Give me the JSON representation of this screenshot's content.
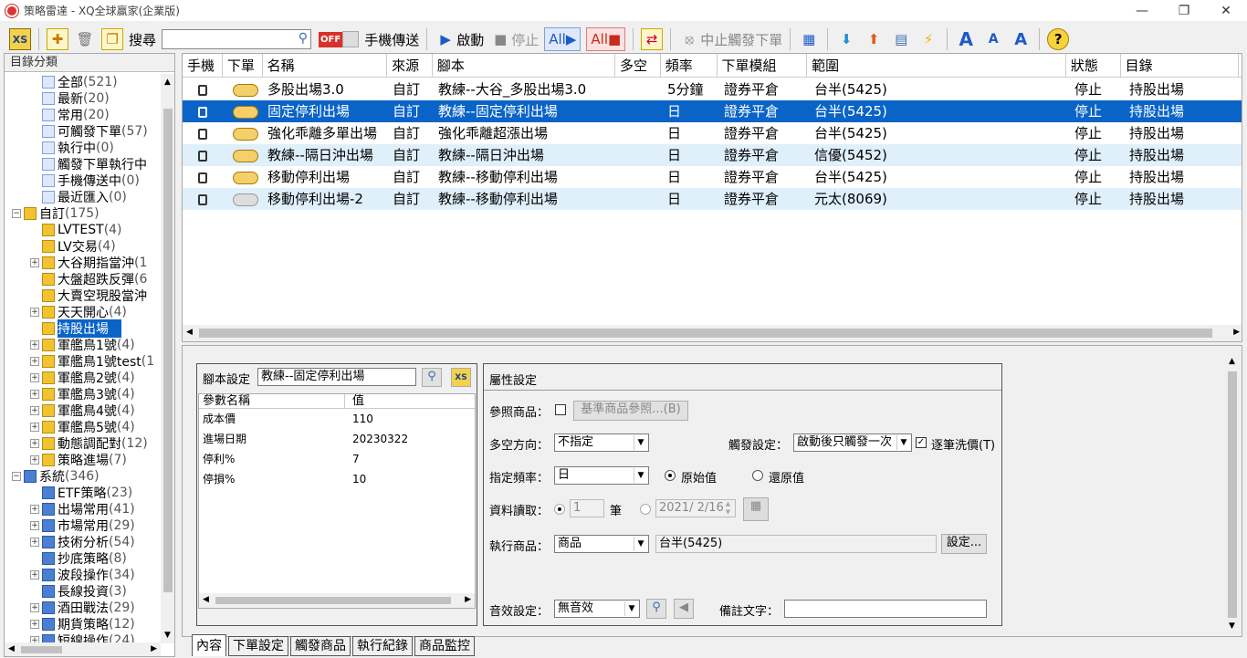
{
  "window": {
    "title": "策略雷達 - XQ全球贏家(企業版)",
    "min_icon": "minimize-icon",
    "restore_icon": "restore-icon",
    "close_icon": "close-icon"
  },
  "toolbar": {
    "search_label": "搜尋",
    "search_value": "",
    "phone_send_label": "手機傳送",
    "start_label": "啟動",
    "stop_label": "停止",
    "all_start_label": "All",
    "all_stop_label": "All",
    "stop_trigger_label": "中止觸發下單",
    "off_label": "OFF"
  },
  "sidebar": {
    "title": "目錄分類",
    "items": [
      {
        "label": "全部",
        "count": "(521)",
        "indent": 2,
        "pm": "",
        "icon": "all-icon"
      },
      {
        "label": "最新",
        "count": "(20)",
        "indent": 2,
        "pm": "",
        "icon": "new-icon"
      },
      {
        "label": "常用",
        "count": "(20)",
        "indent": 2,
        "pm": "",
        "icon": "star-icon"
      },
      {
        "label": "可觸發下單",
        "count": "(57)",
        "indent": 2,
        "pm": "",
        "icon": "trigger-order-icon"
      },
      {
        "label": "執行中",
        "count": "(0)",
        "indent": 2,
        "pm": "",
        "icon": "running-icon"
      },
      {
        "label": "觸發下單執行中",
        "count": "",
        "indent": 2,
        "pm": "",
        "icon": "trigger-running-icon"
      },
      {
        "label": "手機傳送中",
        "count": "(0)",
        "indent": 2,
        "pm": "",
        "icon": "phone-send-icon"
      },
      {
        "label": "最近匯入",
        "count": "(0)",
        "indent": 2,
        "pm": "",
        "icon": "import-icon"
      },
      {
        "label": "自訂",
        "count": "(175)",
        "indent": 0,
        "pm": "−",
        "icon": "folder-icon"
      },
      {
        "label": "LVTEST",
        "count": "(4)",
        "indent": 2,
        "pm": "",
        "icon": "folder-icon"
      },
      {
        "label": "LV交易",
        "count": "(4)",
        "indent": 2,
        "pm": "",
        "icon": "folder-icon"
      },
      {
        "label": "大谷期指當沖",
        "count": "(1",
        "indent": 1,
        "pm": "+",
        "icon": "folder-icon"
      },
      {
        "label": "大盤超跌反彈",
        "count": "(6",
        "indent": 2,
        "pm": "",
        "icon": "folder-icon"
      },
      {
        "label": "大賣空現股當沖",
        "count": "",
        "indent": 2,
        "pm": "",
        "icon": "folder-icon"
      },
      {
        "label": "天天開心",
        "count": "(4)",
        "indent": 1,
        "pm": "+",
        "icon": "folder-icon"
      },
      {
        "label": "持股出場",
        "count": "",
        "indent": 2,
        "pm": "",
        "icon": "folder-icon",
        "selected": true
      },
      {
        "label": "軍艦鳥1號",
        "count": "(4)",
        "indent": 1,
        "pm": "+",
        "icon": "folder-icon"
      },
      {
        "label": "軍艦鳥1號test",
        "count": "(1",
        "indent": 1,
        "pm": "+",
        "icon": "folder-icon"
      },
      {
        "label": "軍艦鳥2號",
        "count": "(4)",
        "indent": 1,
        "pm": "+",
        "icon": "folder-icon"
      },
      {
        "label": "軍艦鳥3號",
        "count": "(4)",
        "indent": 1,
        "pm": "+",
        "icon": "folder-icon"
      },
      {
        "label": "軍艦鳥4號",
        "count": "(4)",
        "indent": 1,
        "pm": "+",
        "icon": "folder-icon"
      },
      {
        "label": "軍艦鳥5號",
        "count": "(4)",
        "indent": 1,
        "pm": "+",
        "icon": "folder-icon"
      },
      {
        "label": "動態調配對",
        "count": "(12)",
        "indent": 1,
        "pm": "+",
        "icon": "folder-icon"
      },
      {
        "label": "策略進場",
        "count": "(7)",
        "indent": 1,
        "pm": "+",
        "icon": "folder-icon"
      },
      {
        "label": "系統",
        "count": "(346)",
        "indent": 0,
        "pm": "−",
        "icon": "system-icon"
      },
      {
        "label": "ETF策略",
        "count": "(23)",
        "indent": 2,
        "pm": "",
        "icon": "system-icon"
      },
      {
        "label": "出場常用",
        "count": "(41)",
        "indent": 1,
        "pm": "+",
        "icon": "system-icon"
      },
      {
        "label": "市場常用",
        "count": "(29)",
        "indent": 1,
        "pm": "+",
        "icon": "system-icon"
      },
      {
        "label": "技術分析",
        "count": "(54)",
        "indent": 1,
        "pm": "+",
        "icon": "system-icon"
      },
      {
        "label": "抄底策略",
        "count": "(8)",
        "indent": 2,
        "pm": "",
        "icon": "system-icon"
      },
      {
        "label": "波段操作",
        "count": "(34)",
        "indent": 1,
        "pm": "+",
        "icon": "system-icon"
      },
      {
        "label": "長線投資",
        "count": "(3)",
        "indent": 2,
        "pm": "",
        "icon": "system-icon"
      },
      {
        "label": "酒田戰法",
        "count": "(29)",
        "indent": 1,
        "pm": "+",
        "icon": "system-icon"
      },
      {
        "label": "期貨策略",
        "count": "(12)",
        "indent": 1,
        "pm": "+",
        "icon": "system-icon"
      },
      {
        "label": "短線操作",
        "count": "(24)",
        "indent": 1,
        "pm": "+",
        "icon": "system-icon"
      }
    ]
  },
  "grid": {
    "columns": [
      "手機",
      "下單",
      "名稱",
      "來源",
      "腳本",
      "多空",
      "頻率",
      "下單模組",
      "範圍",
      "狀態",
      "目錄"
    ],
    "rows": [
      {
        "name": "多股出場3.0",
        "source": "自訂",
        "script": "教練--大谷_多股出場3.0",
        "longshort": "",
        "freq": "5分鐘",
        "module": "證券平倉",
        "range": "台半(5425)",
        "status": "停止",
        "folder": "持股出場",
        "lock": "on",
        "style": ""
      },
      {
        "name": "固定停利出場",
        "source": "自訂",
        "script": "教練--固定停利出場",
        "longshort": "",
        "freq": "日",
        "module": "證券平倉",
        "range": "台半(5425)",
        "status": "停止",
        "folder": "持股出場",
        "lock": "on",
        "style": "sel"
      },
      {
        "name": "強化乖離多單出場",
        "source": "自訂",
        "script": "強化乖離超漲出場",
        "longshort": "",
        "freq": "日",
        "module": "證券平倉",
        "range": "台半(5425)",
        "status": "停止",
        "folder": "持股出場",
        "lock": "on",
        "style": ""
      },
      {
        "name": "教練--隔日沖出場",
        "source": "自訂",
        "script": "教練--隔日沖出場",
        "longshort": "",
        "freq": "日",
        "module": "證券平倉",
        "range": "信優(5452)",
        "status": "停止",
        "folder": "持股出場",
        "lock": "on",
        "style": "alt"
      },
      {
        "name": "移動停利出場",
        "source": "自訂",
        "script": "教練--移動停利出場",
        "longshort": "",
        "freq": "日",
        "module": "證券平倉",
        "range": "台半(5425)",
        "status": "停止",
        "folder": "持股出場",
        "lock": "on",
        "style": ""
      },
      {
        "name": "移動停利出場-2",
        "source": "自訂",
        "script": "教練--移動停利出場",
        "longshort": "",
        "freq": "日",
        "module": "證券平倉",
        "range": "元太(8069)",
        "status": "停止",
        "folder": "持股出場",
        "lock": "off",
        "style": "alt"
      }
    ]
  },
  "script_panel": {
    "label": "腳本設定",
    "value": "教練--固定停利出場",
    "param_header": "參數名稱",
    "value_header": "值",
    "params": [
      {
        "name": "成本價",
        "value": "110"
      },
      {
        "name": "進場日期",
        "value": "20230322"
      },
      {
        "name": "停利%",
        "value": "7"
      },
      {
        "name": "停損%",
        "value": "10"
      }
    ]
  },
  "props": {
    "title": "屬性設定",
    "ref_label": "參照商品：",
    "ref_button": "基準商品參照...(B)",
    "dir_label": "多空方向：",
    "dir_value": "不指定",
    "trigger_label": "觸發設定：",
    "trigger_value": "啟動後只觸發一次",
    "each_wash_label": "逐筆洗價(T)",
    "freq_label": "指定頻率：",
    "freq_value": "日",
    "orig_label": "原始值",
    "restore_label": "還原值",
    "data_label": "資料讀取：",
    "data_count": "1",
    "data_unit": "筆",
    "data_date": "2021/  2/16",
    "exec_label": "執行商品：",
    "exec_value": "商品",
    "exec_target": "台半(5425)",
    "setting_button": "設定...",
    "sound_label": "音效設定：",
    "sound_value": "無音效",
    "note_label": "備註文字：",
    "note_value": ""
  },
  "tabs": [
    "內容",
    "下單設定",
    "觸發商品",
    "執行紀錄",
    "商品監控"
  ]
}
